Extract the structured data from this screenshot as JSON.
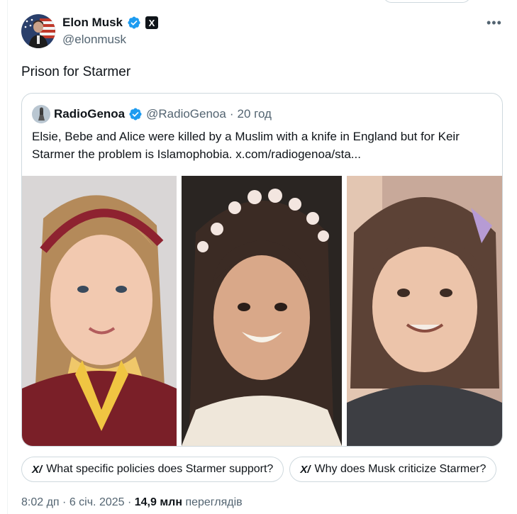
{
  "author": {
    "name": "Elon Musk",
    "handle": "@elonmusk",
    "verified": true,
    "affiliation_badge": "X"
  },
  "tweet": {
    "text": "Prison for Starmer"
  },
  "quoted": {
    "name": "RadioGenoa",
    "handle": "@RadioGenoa",
    "separator": "·",
    "time": "20 год",
    "text": "Elsie, Bebe and Alice were killed by a Muslim with a knife in England but for Keir Starmer the problem is Islamophobia.  x.com/radiogenoa/sta..."
  },
  "suggestions": [
    {
      "label": "What specific policies does Starmer support?"
    },
    {
      "label": "Why does Musk criticize Starmer?"
    }
  ],
  "meta": {
    "time": "8:02 дп",
    "sep1": " · ",
    "date": "6 січ. 2025",
    "sep2": " · ",
    "views_count": "14,9 млн",
    "views_label": " переглядів"
  },
  "icons": {
    "more": "more-horizontal-icon",
    "verified": "verified-badge-icon",
    "grok": "grok-icon"
  },
  "colors": {
    "verified_blue": "#1d9bf0",
    "secondary_text": "#536471",
    "border": "#cfd9de"
  }
}
